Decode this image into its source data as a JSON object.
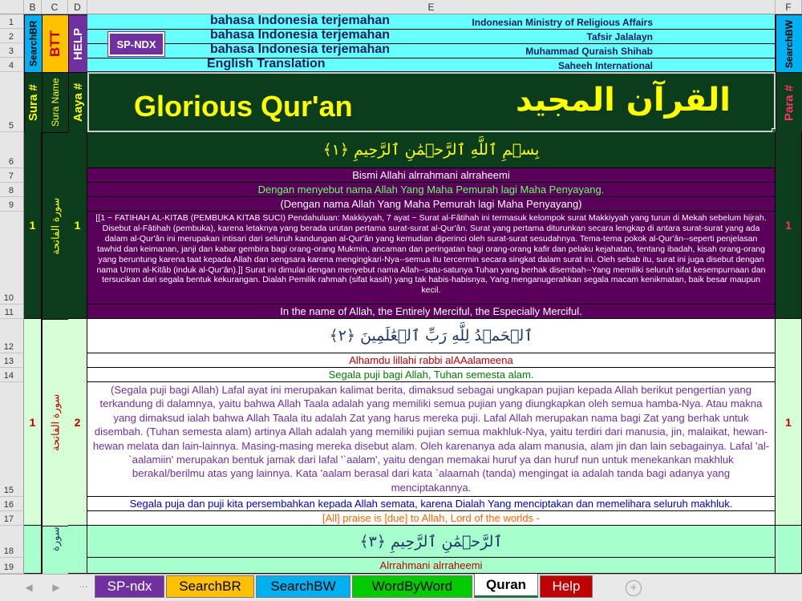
{
  "columns": {
    "b": "B",
    "c": "C",
    "d": "D",
    "e": "E",
    "f": "F"
  },
  "rows": [
    "1",
    "2",
    "3",
    "4",
    "5",
    "6",
    "7",
    "8",
    "9",
    "10",
    "11",
    "12",
    "13",
    "14",
    "15",
    "16",
    "17",
    "18",
    "19"
  ],
  "side": {
    "search_br": "SearchBR",
    "btt": "BTT",
    "help": "HELP",
    "search_bw": "SearchBW",
    "sp_ndx": "SP-NDX"
  },
  "header": {
    "translations": [
      {
        "title": "bahasa Indonesia terjemahan",
        "source": "Indonesian Ministry of Religious Affairs"
      },
      {
        "title": "bahasa Indonesia terjemahan",
        "source": "Tafsir Jalalayn"
      },
      {
        "title": "bahasa Indonesia terjemahan",
        "source": "Muhammad Quraish Shihab"
      },
      {
        "title": "English Translation",
        "source": "Saheeh International"
      }
    ],
    "sura_num": "Sura #",
    "sura_name": "Sura Name",
    "aaya_num": "Aaya #",
    "para_num": "Para #",
    "title_en": "Glorious Qur'an",
    "title_ar": "القرآن المجيد"
  },
  "verses": [
    {
      "sura": "1",
      "sura_name": "سورة الفاتحة",
      "aaya": "1",
      "para": "1",
      "arabic": "بِسۡمِ ٱللَّهِ ٱلرَّحۡمَٰنِ ٱلرَّحِيمِ ﴿١﴾",
      "translit": "Bismi Allahi alrrahmani alrraheemi",
      "kemenag": "Dengan menyebut nama Allah Yang Maha Pemurah lagi Maha Penyayang.",
      "jalalayn_short": "(Dengan nama Allah Yang Maha Pemurah lagi Maha Penyayang)",
      "shihab": "[[1 ~ FATIHAH AL-KITAB (PEMBUKA KITAB SUCI) Pendahuluan: Makkiyyah, 7 ayat ~ Surat al-Fâtihah ini termasuk kelompok surat Makkiyyah yang turun di Mekah sebelum hijrah. Disebut al-Fâtihah (pembuka), karena letaknya yang berada urutan pertama surat-surat al-Qur'ân. Surat yang pertama diturunkan secara lengkap di antara surat-surat yang ada dalam al-Qur'ân ini merupakan intisari dari seluruh kandungan al-Qur'ân yang kemudian diperinci oleh surat-surat sesudahnya. Tema-tema pokok al-Qur'ân--seperti penjelasan tawhid dan keimanan, janji dan kabar gembira bagi orang-orang Mukmin, ancaman dan peringatan bagi orang-orang kafir dan pelaku kejahatan, tentang ibadah, kisah orang-orang yang beruntung karena taat kepada Allah dan sengsara karena mengingkari-Nya--semua itu tercermin secara singkat dalam surat ini. Oleh sebab itu, surat ini juga disebut dengan nama Umm al-Kitâb (induk al-Qur'ân).]] Surat ini dimulai dengan menyebut nama Allah--satu-satunya Tuhan yang berhak disembah--Yang memiliki seluruh sifat kesempurnaan dan tersucikan dari segala bentuk kekurangan. Dialah Pemilik rahmah (sifat kasih) yang tak habis-habisnya, Yang menganugerahkan segala macam kenikmatan, baik besar maupun kecil.",
      "english": "In the name of Allah, the Entirely Merciful, the Especially Merciful."
    },
    {
      "sura": "1",
      "sura_name": "سورة الفاتحة",
      "aaya": "2",
      "para": "1",
      "arabic": "ٱلۡحَمۡدُ لِلَّهِ رَبِّ ٱلۡعَٰلَمِينَ ﴿٢﴾",
      "translit": "Alhamdu lillahi rabbi alAAalameena",
      "kemenag": "Segala puji bagi Allah, Tuhan semesta alam.",
      "jalalayn": "(Segala puji bagi Allah) Lafal ayat ini merupakan kalimat berita, dimaksud sebagai ungkapan pujian kepada Allah berikut pengertian yang terkandung di dalamnya, yaitu bahwa Allah Taala adalah yang memiliki semua pujian yang diungkapkan oleh semua hamba-Nya. Atau makna yang dimaksud ialah bahwa Allah Taala itu adalah Zat yang harus mereka puji. Lafal Allah merupakan nama bagi Zat yang berhak untuk disembah. (Tuhan semesta alam) artinya Allah adalah yang memiliki pujian semua makhluk-Nya, yaitu terdiri dari manusia, jin, malaikat, hewan-hewan melata dan lain-lainnya. Masing-masing mereka disebut alam. Oleh karenanya ada alam manusia, alam jin dan lain sebagainya. Lafal 'al-`aalamiin' merupakan bentuk jamak dari lafal '`aalam', yaitu dengan memakai huruf ya dan huruf nun untuk menekankan makhluk berakal/berilmu atas yang lainnya. Kata 'aalam berasal dari kata `alaamah (tanda) mengingat ia adalah tanda bagi adanya yang menciptakannya.",
      "shihab": "Segala puja dan puji kita persembahkan kepada Allah semata, karena Dialah Yang menciptakan dan memelihara seluruh makhluk.",
      "english": "[All] praise is [due] to Allah, Lord of the worlds -"
    },
    {
      "sura_name": "سورة",
      "arabic": "ٱلرَّحۡمَٰنِ ٱلرَّحِيمِ ﴿٣﴾",
      "translit": "Alrrahmani alrraheemi"
    }
  ],
  "tabs": [
    {
      "label": "SP-ndx",
      "color": "#7030a0",
      "text": "#ffffff"
    },
    {
      "label": "SearchBR",
      "color": "#ffc000",
      "text": "#000000"
    },
    {
      "label": "SearchBW",
      "color": "#00b0f0",
      "text": "#000000"
    },
    {
      "label": "WordByWord",
      "color": "#00cc00",
      "text": "#000000"
    },
    {
      "label": "Quran",
      "color": "#ffffff",
      "text": "#000000"
    },
    {
      "label": "Help",
      "color": "#c00000",
      "text": "#ffffff"
    }
  ]
}
